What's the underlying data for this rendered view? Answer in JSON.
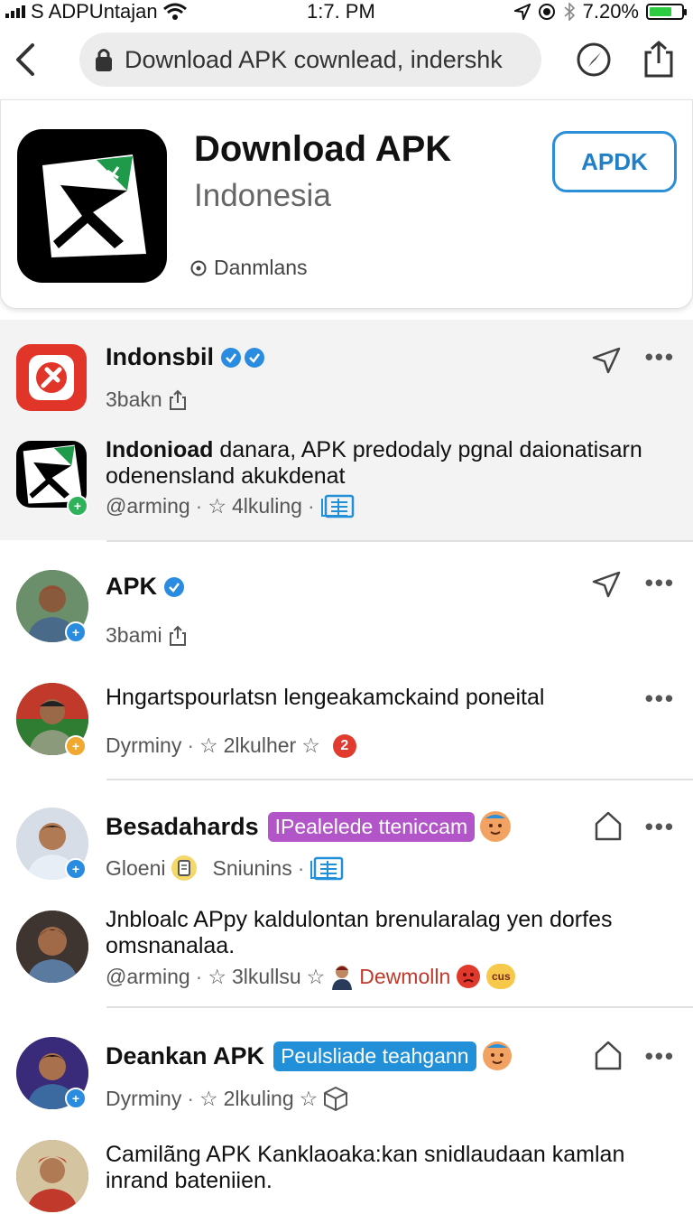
{
  "status_bar": {
    "carrier": "S ADPUntajan",
    "time": "1:7. PM",
    "battery": "7.20%",
    "battery_level": 0.72
  },
  "browser": {
    "url": "Download APK cownlead, indershk",
    "icons": [
      "back-icon",
      "lock-icon",
      "compass-icon",
      "share-icon"
    ]
  },
  "app_header": {
    "title": "Download APK",
    "subtitle": "Indonesia",
    "meta": "Danmlans",
    "button_label": "APDK",
    "accent_color": "#2a8fd8",
    "icon_accent": "#1e9a4a"
  },
  "feed": [
    {
      "name": "Indonsbil",
      "sub": "3bakn",
      "verified": 2
    },
    {
      "text_bold": "Indonioad",
      "text": " danara, APK predodaly pgnal daionatisarn odenensland akukdenat",
      "handle": "@arming",
      "rating": "4lkuling"
    },
    {
      "name": "APK",
      "sub": "3bami"
    },
    {
      "text": "Hngartspourlatsn lengeakamckaind poneital",
      "handle": "Dyrminy",
      "rating": "2lkulher",
      "badge_count": "2"
    },
    {
      "name": "Besadahards",
      "tag": "IPealelede tteniccam",
      "tag_color": "#b255c9",
      "sub_a": "Gloeni",
      "sub_b": "Sniunins"
    },
    {
      "text": "Jnbloalc APpy kaldulontan brenularalag yen dorfes omsnanalaa.",
      "handle": "@arming",
      "rating": "3lkullsu",
      "red_name": "Dewmolln",
      "face_label": "cus"
    },
    {
      "name": "Deankan APK",
      "tag": "Peulsliade teahgann",
      "tag_color": "#2190d8",
      "handle": "Dyrminy",
      "rating": "2lkuling"
    },
    {
      "text": "Camilãng APK Kanklaoaka:kan snidlaudaan kamlan inrand bateniien."
    }
  ]
}
